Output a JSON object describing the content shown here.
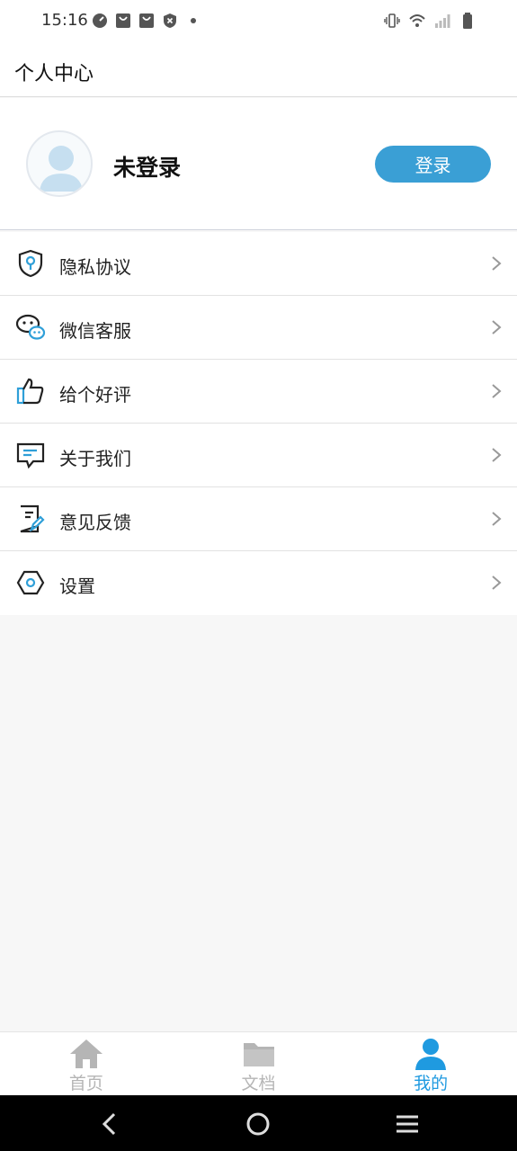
{
  "status_bar": {
    "time": "15:16"
  },
  "header": {
    "title": "个人中心"
  },
  "profile": {
    "name": "未登录",
    "login_label": "登录"
  },
  "menu": {
    "items": [
      {
        "label": "隐私协议",
        "icon": "shield-icon"
      },
      {
        "label": "微信客服",
        "icon": "wechat-icon"
      },
      {
        "label": "给个好评",
        "icon": "thumbs-up-icon"
      },
      {
        "label": "关于我们",
        "icon": "message-icon"
      },
      {
        "label": "意见反馈",
        "icon": "feedback-icon"
      },
      {
        "label": "设置",
        "icon": "settings-icon"
      }
    ]
  },
  "tabbar": {
    "tabs": [
      {
        "label": "首页",
        "icon": "home-icon",
        "active": false
      },
      {
        "label": "文档",
        "icon": "folder-icon",
        "active": false
      },
      {
        "label": "我的",
        "icon": "user-icon",
        "active": true
      }
    ]
  },
  "colors": {
    "accent": "#3a9fd5",
    "active_tab": "#1f9ae0",
    "inactive_tab": "#b5b5b5"
  }
}
